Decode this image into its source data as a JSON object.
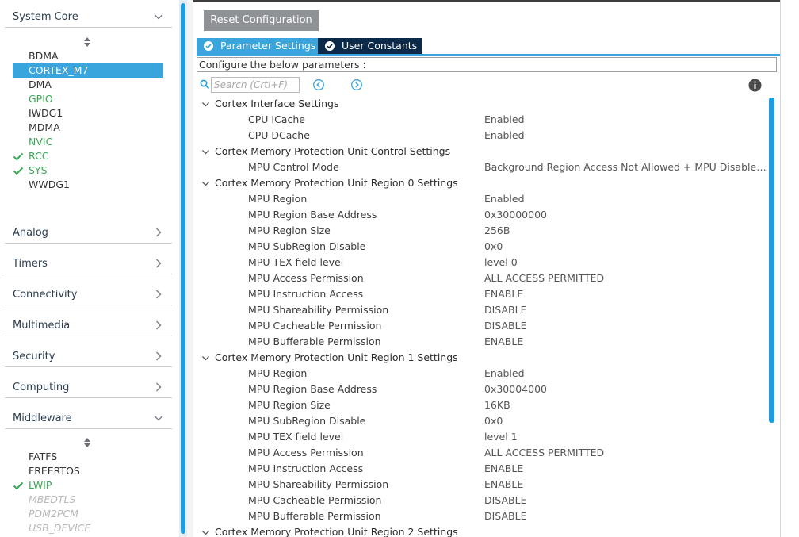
{
  "sidebar": {
    "categories": {
      "system_core": "System Core",
      "analog": "Analog",
      "timers": "Timers",
      "connectivity": "Connectivity",
      "multimedia": "Multimedia",
      "security": "Security",
      "computing": "Computing",
      "middleware": "Middleware"
    },
    "system_core_items": [
      {
        "label": "BDMA",
        "state": "normal"
      },
      {
        "label": "CORTEX_M7",
        "state": "selected"
      },
      {
        "label": "DMA",
        "state": "normal"
      },
      {
        "label": "GPIO",
        "state": "green"
      },
      {
        "label": "IWDG1",
        "state": "normal"
      },
      {
        "label": "MDMA",
        "state": "normal"
      },
      {
        "label": "NVIC",
        "state": "green"
      },
      {
        "label": "RCC",
        "state": "checked"
      },
      {
        "label": "SYS",
        "state": "checked"
      },
      {
        "label": "WWDG1",
        "state": "normal"
      }
    ],
    "middleware_items": [
      {
        "label": "FATFS",
        "state": "normal"
      },
      {
        "label": "FREERTOS",
        "state": "normal"
      },
      {
        "label": "LWIP",
        "state": "checked"
      },
      {
        "label": "MBEDTLS",
        "state": "disabled"
      },
      {
        "label": "PDM2PCM",
        "state": "disabled"
      },
      {
        "label": "USB_DEVICE",
        "state": "disabled"
      }
    ]
  },
  "toolbar": {
    "reset_label": "Reset Configuration"
  },
  "tabs": {
    "parameter_settings": "Parameter Settings",
    "user_constants": "User Constants"
  },
  "configure_text": "Configure the below parameters :",
  "search": {
    "placeholder": "Search (Crtl+F)"
  },
  "groups": [
    {
      "name": "Cortex Interface Settings",
      "params": [
        {
          "name": "CPU ICache",
          "value": "Enabled"
        },
        {
          "name": "CPU DCache",
          "value": "Enabled"
        }
      ]
    },
    {
      "name": "Cortex Memory Protection Unit Control Settings",
      "params": [
        {
          "name": "MPU Control Mode",
          "value": "Background Region Access Not Allowed + MPU Disabled d..."
        }
      ]
    },
    {
      "name": "Cortex Memory Protection Unit Region 0 Settings",
      "params": [
        {
          "name": "MPU Region",
          "value": "Enabled"
        },
        {
          "name": "MPU Region Base Address",
          "value": "0x30000000"
        },
        {
          "name": "MPU Region Size",
          "value": "256B"
        },
        {
          "name": "MPU SubRegion Disable",
          "value": "0x0"
        },
        {
          "name": "MPU TEX field level",
          "value": "level 0"
        },
        {
          "name": "MPU Access Permission",
          "value": "ALL ACCESS PERMITTED"
        },
        {
          "name": "MPU Instruction Access",
          "value": "ENABLE"
        },
        {
          "name": "MPU Shareability Permission",
          "value": "DISABLE"
        },
        {
          "name": "MPU Cacheable Permission",
          "value": "DISABLE"
        },
        {
          "name": "MPU Bufferable  Permission",
          "value": "ENABLE"
        }
      ]
    },
    {
      "name": "Cortex Memory Protection Unit Region 1 Settings",
      "params": [
        {
          "name": "MPU Region",
          "value": "Enabled"
        },
        {
          "name": "MPU Region Base Address",
          "value": "0x30004000"
        },
        {
          "name": "MPU Region Size",
          "value": "16KB"
        },
        {
          "name": "MPU SubRegion Disable",
          "value": "0x0"
        },
        {
          "name": "MPU TEX field level",
          "value": "level 1"
        },
        {
          "name": "MPU Access Permission",
          "value": "ALL ACCESS PERMITTED"
        },
        {
          "name": "MPU Instruction Access",
          "value": "ENABLE"
        },
        {
          "name": "MPU Shareability Permission",
          "value": "ENABLE"
        },
        {
          "name": "MPU Cacheable Permission",
          "value": "DISABLE"
        },
        {
          "name": "MPU Bufferable  Permission",
          "value": "DISABLE"
        }
      ]
    },
    {
      "name": "Cortex Memory Protection Unit Region 2 Settings",
      "params": []
    }
  ],
  "icons": {
    "check": "check-icon",
    "chevron_down": "chevron-down-icon",
    "chevron_right": "chevron-right-icon",
    "sort": "sort-icon",
    "search": "search-icon",
    "prev": "previous-match-icon",
    "next": "next-match-icon",
    "info": "info-icon"
  },
  "colors": {
    "accent": "#3aa4dc",
    "tab_dark": "#0b2a4a",
    "green": "#3aa757",
    "reset_button": "#8e9196",
    "scrollbar": "#1f9ddf"
  }
}
